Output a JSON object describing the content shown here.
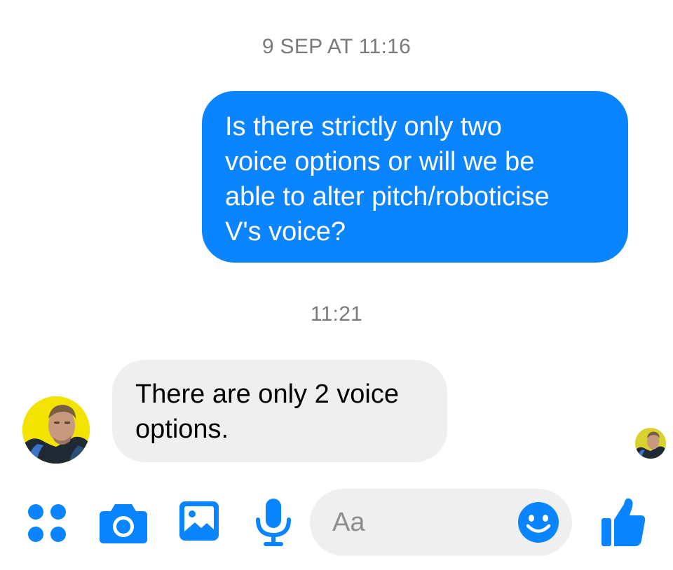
{
  "conversation": {
    "timestamps": [
      "9 SEP AT 11:16",
      "11:21"
    ],
    "messages": [
      {
        "direction": "outgoing",
        "lines": [
          "Is there strictly only two",
          "voice options or will we be",
          "able to alter pitch/roboticise",
          "V's voice?"
        ]
      },
      {
        "direction": "incoming",
        "lines": [
          "There are only 2 voice",
          "options."
        ]
      }
    ]
  },
  "composer": {
    "placeholder": "Aa",
    "icons": [
      "apps-icon",
      "camera-icon",
      "gallery-icon",
      "microphone-icon",
      "emoji-icon",
      "thumbs-up-icon"
    ]
  },
  "colors": {
    "accent": "#0a84ff",
    "outgoing_bubble": "#0a84ff",
    "incoming_bubble": "#efefef",
    "timestamp_text": "#7a7a7a",
    "avatar_background": "#f2e400"
  }
}
